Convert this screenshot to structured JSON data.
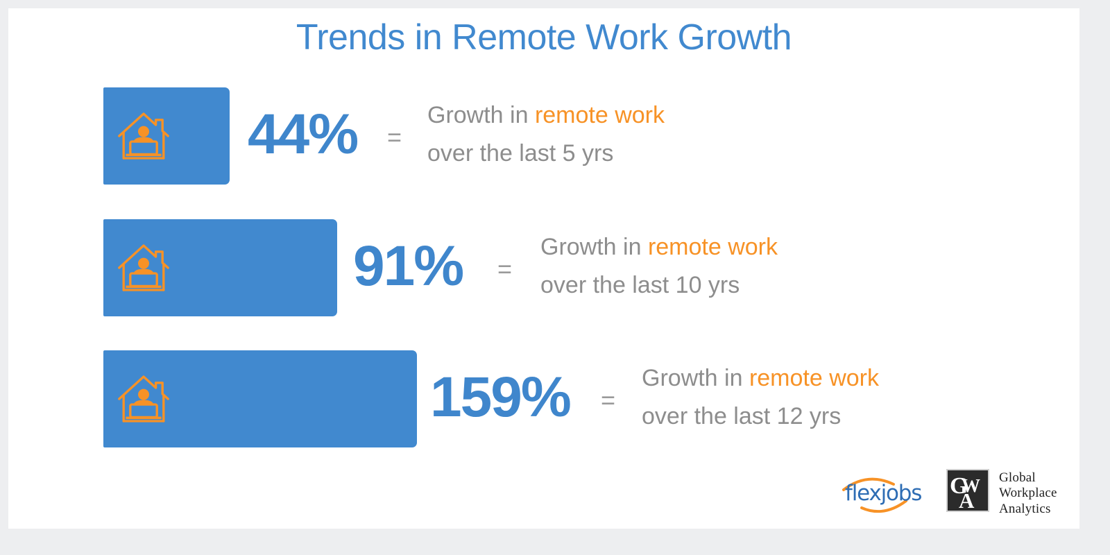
{
  "page": {
    "title": "Trends in Remote Work Growth",
    "background_color": "#edeef0",
    "canvas_color": "#ffffff",
    "accent_blue": "#4189cf",
    "accent_orange": "#f79226",
    "text_grey": "#8d8d8d"
  },
  "rows": [
    {
      "percent": "44%",
      "equals": "=",
      "caption_prefix": "Growth in ",
      "caption_highlight": "remote work",
      "caption_line2": "over the last 5 yrs",
      "icon": "house-remote-worker-icon"
    },
    {
      "percent": "91%",
      "equals": "=",
      "caption_prefix": "Growth in ",
      "caption_highlight": "remote work",
      "caption_line2": "over the last 10 yrs",
      "icon": "house-remote-worker-icon"
    },
    {
      "percent": "159%",
      "equals": "=",
      "caption_prefix": "Growth in ",
      "caption_highlight": "remote work",
      "caption_line2": "over the last 12 yrs",
      "icon": "house-remote-worker-icon"
    }
  ],
  "footer": {
    "flexjobs_logo_text": "flexjobs",
    "gwa_monogram": "GWA",
    "gwa_line1": "Global",
    "gwa_line2": "Workplace",
    "gwa_line3": "Analytics"
  },
  "chart_data": {
    "type": "bar",
    "title": "Trends in Remote Work Growth",
    "orientation": "horizontal",
    "categories": [
      "Growth in remote work over the last 5 yrs",
      "Growth in remote work over the last 10 yrs",
      "Growth in remote work over the last 12 yrs"
    ],
    "values": [
      44,
      91,
      159
    ],
    "value_labels": [
      "44%",
      "91%",
      "159%"
    ],
    "unit": "percent",
    "xlabel": "",
    "ylabel": "",
    "xlim": [
      0,
      159
    ],
    "grid": false,
    "legend": "none",
    "series": [
      {
        "name": "Growth in remote work",
        "values": [
          44,
          91,
          159
        ]
      }
    ],
    "bar_color": "#4189cf",
    "label_color": "#3f86cc",
    "annotations": [
      "Growth in remote work over the last 5 yrs",
      "Growth in remote work over the last 10 yrs",
      "Growth in remote work over the last 12 yrs"
    ]
  }
}
